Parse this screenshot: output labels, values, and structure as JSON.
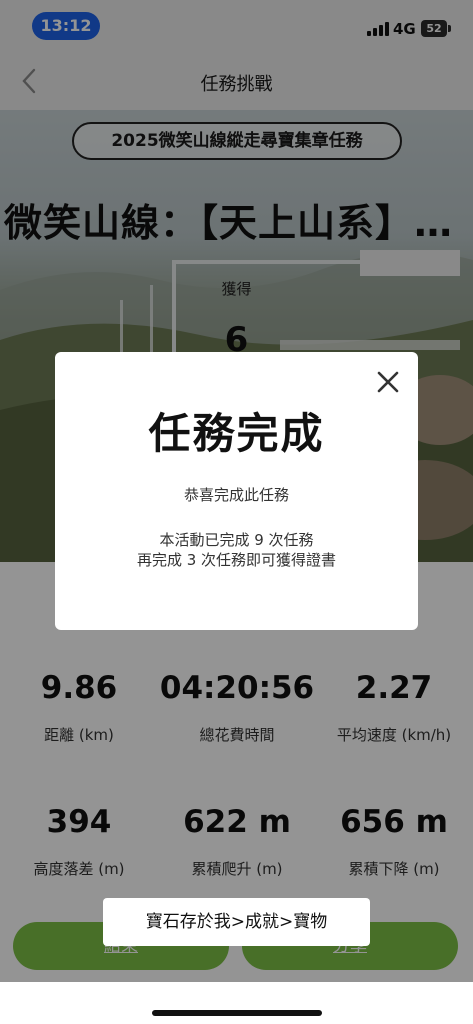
{
  "status_bar": {
    "time": "13:12",
    "network": "4G",
    "battery": "52"
  },
  "nav": {
    "title": "任務挑戰"
  },
  "hero": {
    "event_badge": "2025微笑山線縱走尋寶集章任務",
    "route_name": "微笑山線：【天上山系】…",
    "obtained_label": "獲得",
    "obtained_count": "6"
  },
  "stats": [
    {
      "value": "9.86",
      "label": "距離 (km)"
    },
    {
      "value": "04:20:56",
      "label": "總花費時間"
    },
    {
      "value": "2.27",
      "label": "平均速度 (km/h)"
    },
    {
      "value": "394",
      "label": "高度落差 (m)"
    },
    {
      "value": "622 m",
      "label": "累積爬升 (m)"
    },
    {
      "value": "656 m",
      "label": "累積下降 (m)"
    }
  ],
  "buttons": {
    "end": "結束",
    "share": "分享"
  },
  "modal": {
    "title": "任務完成",
    "message": "恭喜完成此任務",
    "progress_line1": "本活動已完成 9 次任務",
    "progress_line2": "再完成 3 次任務即可獲得證書"
  },
  "toast": {
    "text": "寶石存於我>成就>寶物"
  },
  "colors": {
    "accent_green": "#7cbf45",
    "time_pill": "#1e63e9"
  }
}
